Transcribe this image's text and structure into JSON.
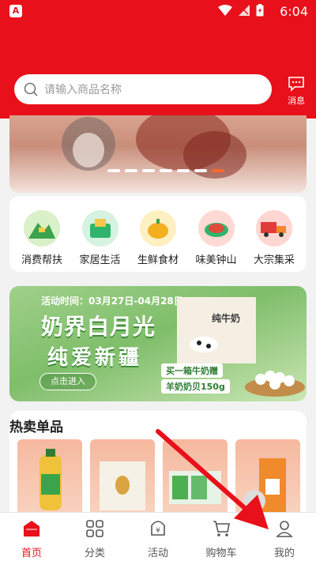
{
  "status_bar": {
    "time": "6:04",
    "app_badge": "A"
  },
  "header": {
    "search": {
      "placeholder": "请输入商品名称"
    },
    "message_label": "消息"
  },
  "banner": {
    "slides": 7,
    "active_slide": 7
  },
  "categories": [
    {
      "label": "消费帮扶",
      "color": "#3aa34b"
    },
    {
      "label": "家居生活",
      "color": "#2fb46c"
    },
    {
      "label": "生鲜食材",
      "color": "#f2b01e"
    },
    {
      "label": "味美钟山",
      "color": "#e04a3a"
    },
    {
      "label": "大宗集采",
      "color": "#e23b3b"
    }
  ],
  "promo": {
    "date": "活动时间：03月27日-04月28日",
    "title_line1": "奶界白月光",
    "title_line2": "纯爱新疆",
    "enter_button": "点击进入",
    "deal_line1": "买一箱牛奶赠",
    "deal_line2": "羊奶奶贝150g",
    "box_text": "纯牛奶"
  },
  "hot_section": {
    "title": "热卖单品"
  },
  "tabbar": [
    {
      "label": "首页",
      "icon": "home-icon",
      "active": true
    },
    {
      "label": "分类",
      "icon": "category-icon",
      "active": false
    },
    {
      "label": "活动",
      "icon": "activity-icon",
      "active": false
    },
    {
      "label": "购物车",
      "icon": "cart-icon",
      "active": false
    },
    {
      "label": "我的",
      "icon": "profile-icon",
      "active": false
    }
  ],
  "colors": {
    "brand_red": "#e8101a",
    "indicator_orange": "#ff6a2b",
    "annotation_arrow": "#e8101a"
  }
}
